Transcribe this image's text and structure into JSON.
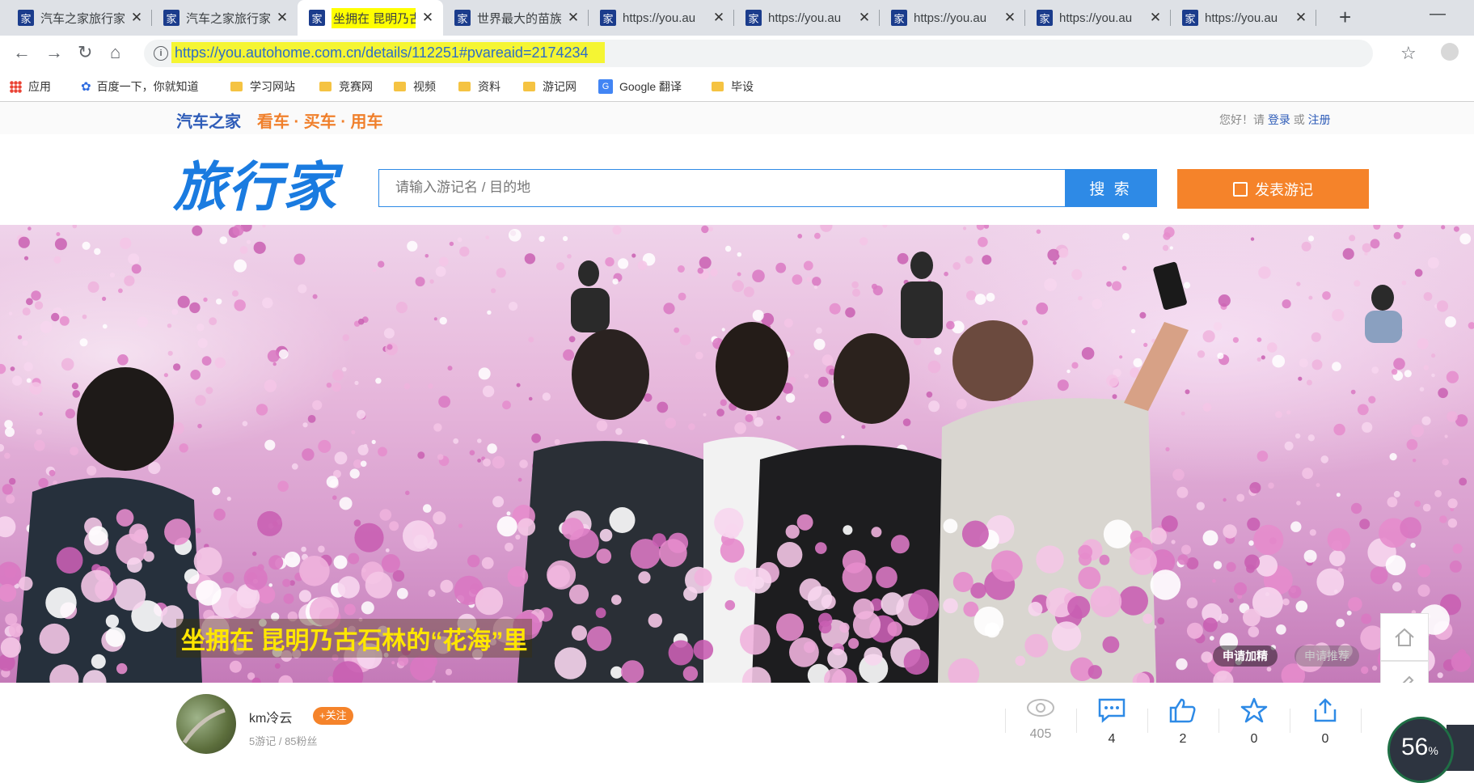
{
  "browser": {
    "tabs": [
      {
        "title": "汽车之家旅行家",
        "active": false
      },
      {
        "title": "汽车之家旅行家",
        "active": false
      },
      {
        "title": "坐拥在 昆明乃古",
        "active": true
      },
      {
        "title": "世界最大的苗族",
        "active": false
      },
      {
        "title": "https://you.au",
        "active": false
      },
      {
        "title": "https://you.au",
        "active": false
      },
      {
        "title": "https://you.au",
        "active": false
      },
      {
        "title": "https://you.au",
        "active": false
      },
      {
        "title": "https://you.au",
        "active": false
      }
    ],
    "favicon_glyph": "家",
    "url": "https://you.autohome.com.cn/details/112251#pvareaid=2174234",
    "bookmarks": [
      {
        "label": "应用",
        "icon": "apps-grid-icon"
      },
      {
        "label": "百度一下，你就知道",
        "icon": "baidu-paw-icon"
      },
      {
        "label": "学习网站",
        "icon": "folder-icon"
      },
      {
        "label": "竞赛网",
        "icon": "folder-icon"
      },
      {
        "label": "视频",
        "icon": "folder-icon"
      },
      {
        "label": "资料",
        "icon": "folder-icon"
      },
      {
        "label": "游记网",
        "icon": "folder-icon"
      },
      {
        "label": "Google 翻译",
        "icon": "google-translate-icon"
      },
      {
        "label": "毕设",
        "icon": "folder-icon"
      }
    ]
  },
  "site": {
    "brand": "汽车之家",
    "brand_tags": "看车 · 买车 · 用车",
    "greeting": "您好！请",
    "login": "登录",
    "or": "或",
    "register": "注册",
    "logo": "旅行家",
    "search_placeholder": "请输入游记名 / 目的地",
    "search_button": "搜 索",
    "publish_button": "发表游记"
  },
  "hero": {
    "title": "坐拥在 昆明乃古石林的“花海”里",
    "apply_featured": "申请加精",
    "apply_recommend": "申请推荐"
  },
  "author": {
    "name": "km冷云",
    "follow": "+关注",
    "stats": "5游记 / 85粉丝"
  },
  "stats": {
    "views": "405",
    "comments": "4",
    "likes": "2",
    "favorites": "0",
    "shares": "0"
  },
  "widget": {
    "percent": "56",
    "percent_sign": "%"
  },
  "colors": {
    "brand_blue": "#1a7be0",
    "accent_orange": "#f5832a",
    "title_yellow": "#ffe600"
  }
}
